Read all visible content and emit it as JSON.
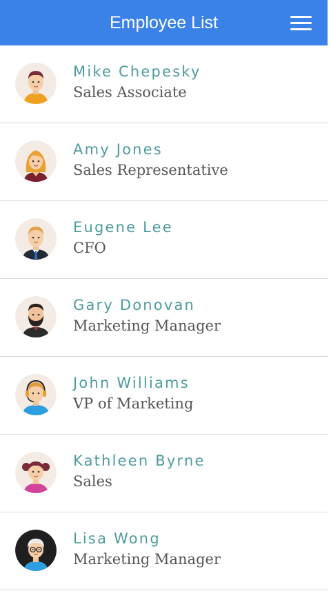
{
  "header": {
    "title": "Employee List",
    "menu_icon": "hamburger-menu-icon",
    "background": "#3b82e8"
  },
  "employees": [
    {
      "name": "Mike Chepesky",
      "title": "Sales Associate",
      "avatar": "man-orange-shirt-avatar-icon"
    },
    {
      "name": "Amy Jones",
      "title": "Sales Representative",
      "avatar": "woman-blonde-avatar-icon"
    },
    {
      "name": "Eugene Lee",
      "title": "CFO",
      "avatar": "man-suit-tie-avatar-icon"
    },
    {
      "name": "Gary Donovan",
      "title": "Marketing Manager",
      "avatar": "man-beard-avatar-icon"
    },
    {
      "name": "John Williams",
      "title": "VP of Marketing",
      "avatar": "man-headset-avatar-icon"
    },
    {
      "name": "Kathleen Byrne",
      "title": "Sales",
      "avatar": "girl-pigtails-avatar-icon"
    },
    {
      "name": "Lisa Wong",
      "title": "Marketing Manager",
      "avatar": "woman-glasses-avatar-icon"
    }
  ],
  "colors": {
    "name_text": "#4e9a9e",
    "title_text": "#555555",
    "avatar_bg": "#f3ebe4",
    "divider": "#d9d9d9"
  }
}
